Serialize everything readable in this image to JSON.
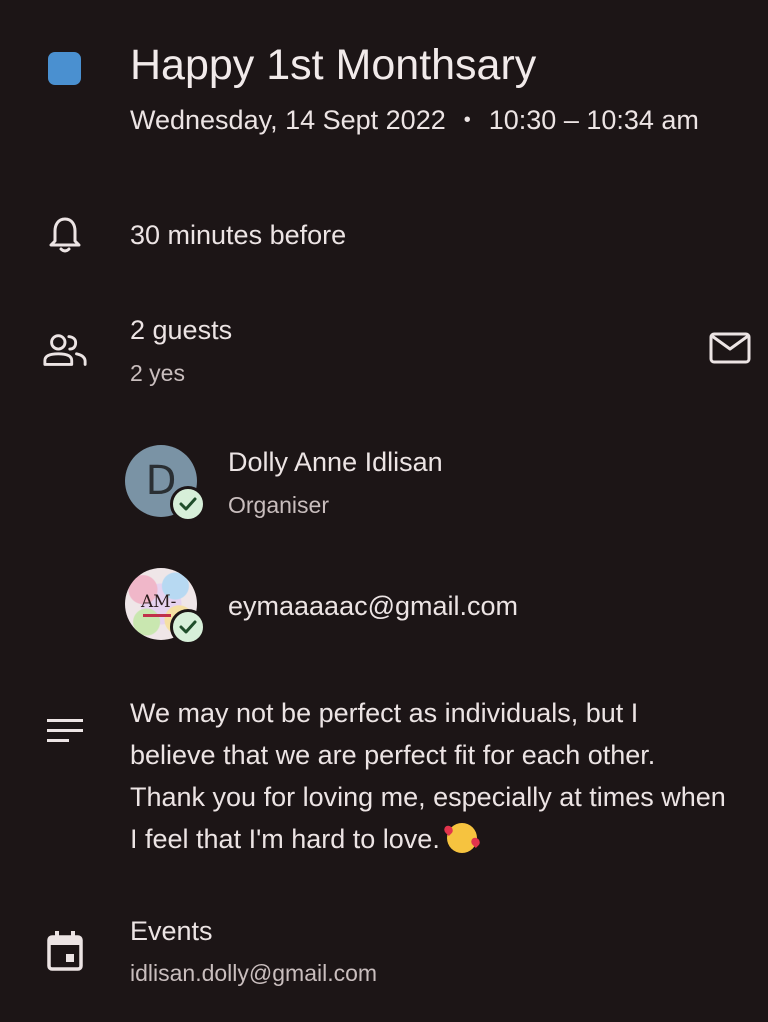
{
  "event": {
    "title": "Happy 1st Monthsary",
    "date": "Wednesday, 14 Sept 2022",
    "separator": "•",
    "time": "10:30 – 10:34 am",
    "color": "#4a90d0"
  },
  "reminder": {
    "icon": "bell-icon",
    "text": "30 minutes before"
  },
  "guests": {
    "icon": "people-icon",
    "count_label": "2 guests",
    "response_summary": "2 yes",
    "email_icon": "mail-icon",
    "list": [
      {
        "avatar_initial": "D",
        "name": "Dolly Anne Idlisan",
        "role": "Organiser",
        "status": "accepted"
      },
      {
        "avatar_text": "AM-",
        "name": "eymaaaaac@gmail.com",
        "status": "accepted"
      }
    ]
  },
  "description": {
    "icon": "notes-icon",
    "text": "We may not be perfect as individuals, but I believe that we are perfect fit for each other. Thank you for loving me, especially at times when I feel that I'm hard to love.",
    "emoji": "smiling-face-with-hearts"
  },
  "calendar": {
    "icon": "calendar-icon",
    "name": "Events",
    "account": "idlisan.dolly@gmail.com"
  }
}
